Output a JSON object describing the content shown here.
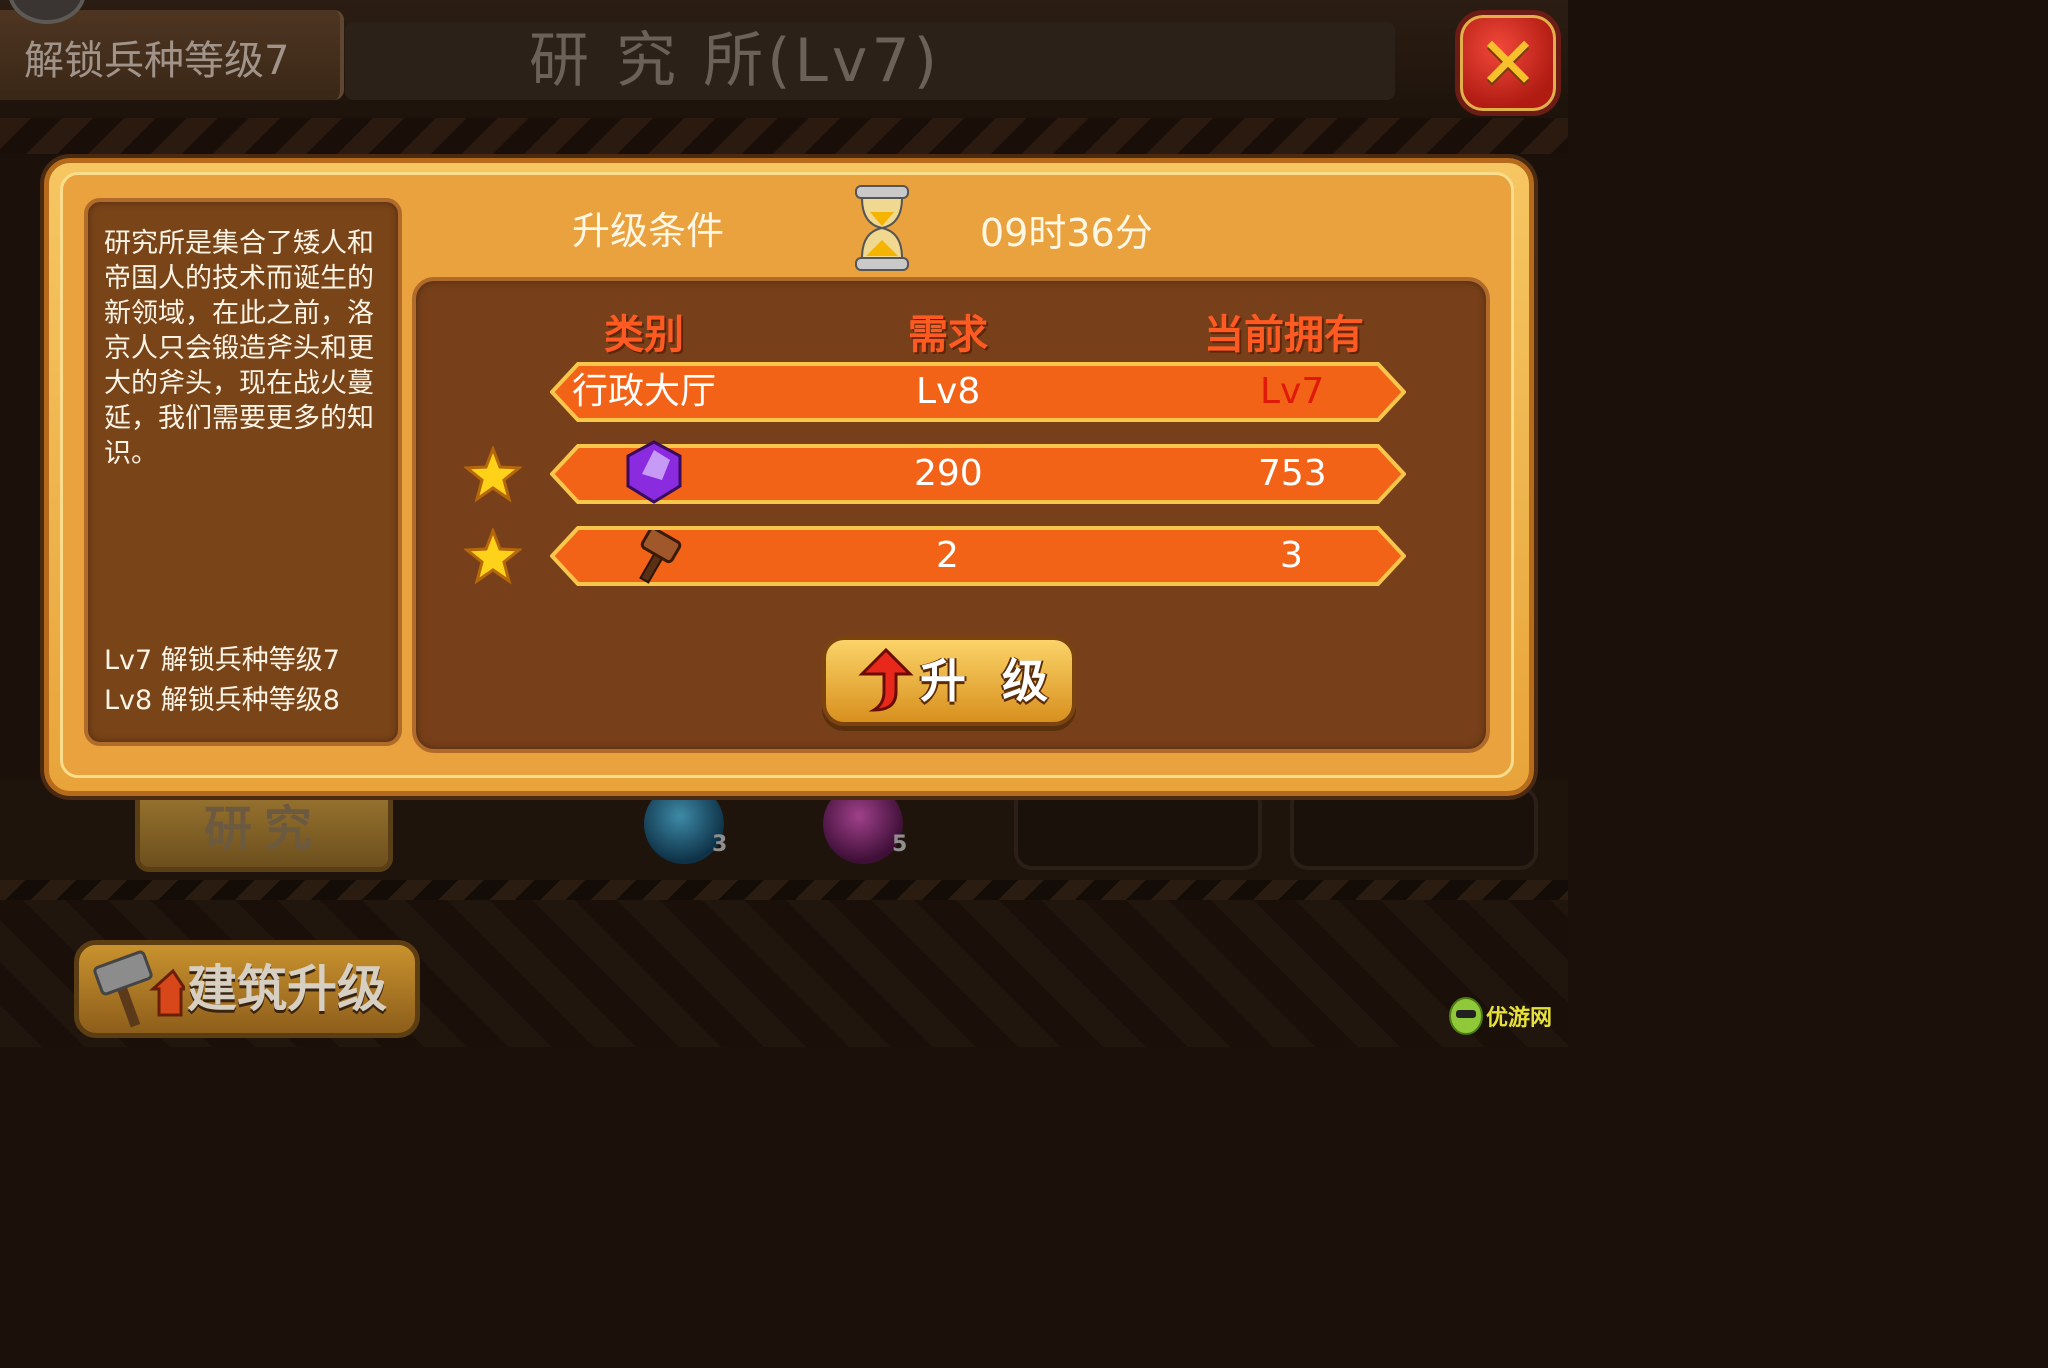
{
  "header": {
    "unlock_tab": "解锁兵种等级7",
    "title": "研 究 所(Lv7)"
  },
  "dialog": {
    "description": "研究所是集合了矮人和帝国人的技术而诞生的新领域，在此之前，洛京人只会锻造斧头和更大的斧头，现在战火蔓延，我们需要更多的知识。",
    "levels": [
      "Lv7 解锁兵种等级7",
      "Lv8 解锁兵种等级8"
    ],
    "condition_label": "升级条件",
    "timer": "09时36分",
    "columns": {
      "category": "类别",
      "required": "需求",
      "owned": "当前拥有"
    },
    "rows": [
      {
        "category": "行政大厅",
        "required": "Lv8",
        "owned": "Lv7",
        "owned_color": "#e01a0a",
        "icon": "town-hall"
      },
      {
        "category": "",
        "required": "290",
        "owned": "753",
        "icon": "purple-gem-icon",
        "starred": true
      },
      {
        "category": "",
        "required": "2",
        "owned": "3",
        "icon": "hammer-icon",
        "starred": true
      }
    ],
    "upgrade_label": "升 级"
  },
  "background": {
    "research_tab": "研究",
    "fist_blue_count": "3",
    "fist_purple_count": "5",
    "build_upgrade": "建筑升级",
    "watermark": "优游网"
  },
  "colors": {
    "bar_fill": "#f26318",
    "bar_border": "#f8c64a",
    "header_accent": "#ff5a22",
    "warning_red": "#e01a0a"
  }
}
